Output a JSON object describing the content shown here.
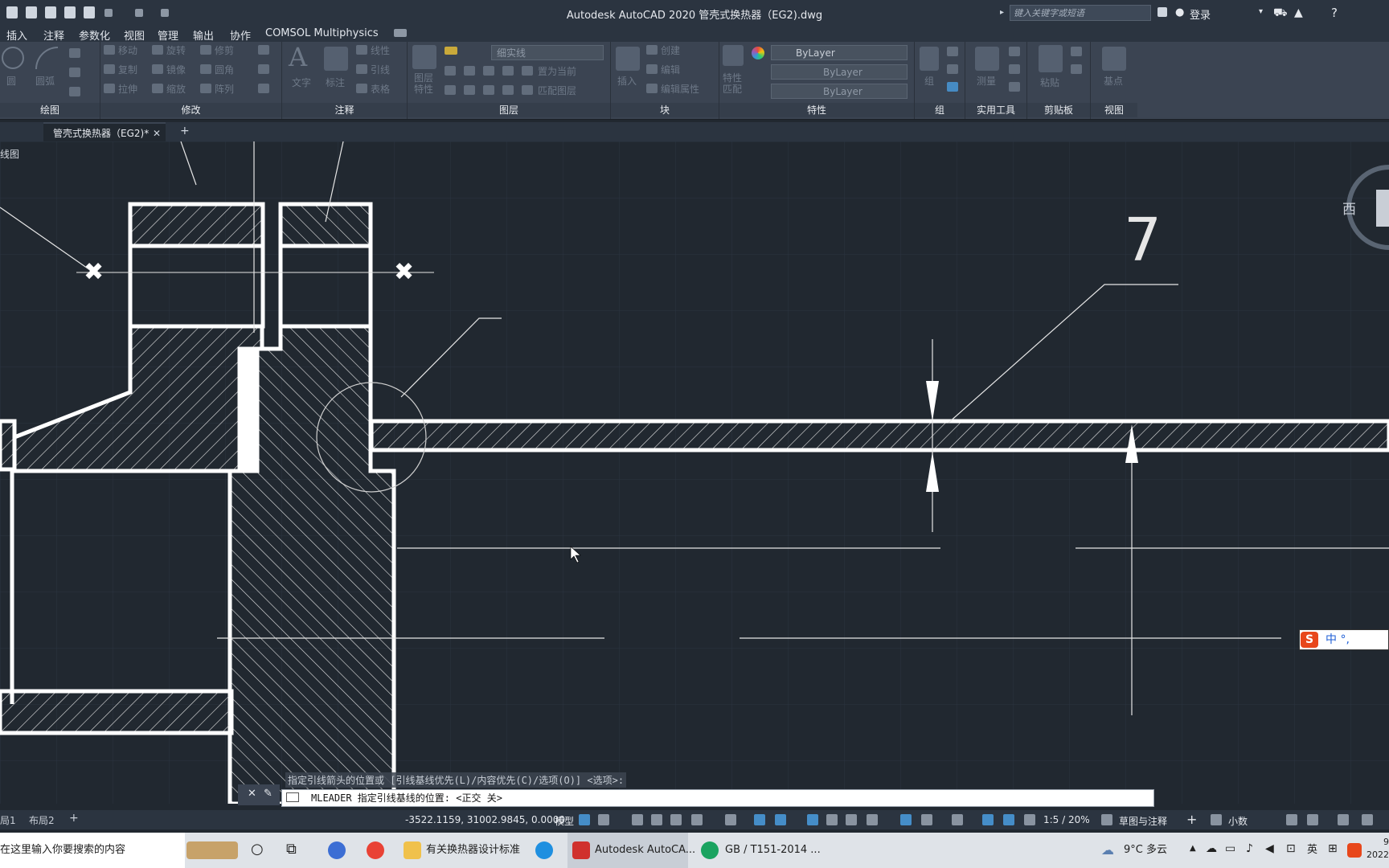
{
  "titlebar": {
    "title": "Autodesk AutoCAD 2020    管壳式换热器（EG2).dwg",
    "search_placeholder": "键入关键字或短语",
    "login_label": "登录"
  },
  "menu": [
    "插入",
    "注释",
    "参数化",
    "视图",
    "管理",
    "输出",
    "协作",
    "COMSOL Multiphysics"
  ],
  "ribbon": {
    "panels": {
      "draw": "绘图",
      "modify": "修改",
      "annotation": "注释",
      "layers": "图层",
      "block": "块",
      "properties": "特性",
      "groups": "组",
      "utilities": "实用工具",
      "clipboard": "剪贴板",
      "view": "视图"
    },
    "draw_tools": {
      "circle": "圆",
      "arc": "圆弧"
    },
    "modify_tools": [
      "移动",
      "旋转",
      "修剪",
      "复制",
      "镜像",
      "圆角",
      "拉伸",
      "缩放",
      "阵列"
    ],
    "annotation_tools": {
      "text": "文字",
      "dimension": "标注",
      "linear": "线性",
      "leader": "引线",
      "table": "表格"
    },
    "layer_tools": {
      "layer_props": "图层\n特性",
      "layer_combo": "细实线",
      "set_current": "置为当前",
      "match_layer": "匹配图层"
    },
    "block_tools": {
      "insert": "插入",
      "create": "创建",
      "edit": "编辑",
      "edit_attr": "编辑属性"
    },
    "properties_tools": {
      "match": "特性\n匹配",
      "color": "ByLayer",
      "linetype": "ByLayer",
      "lineweight": "ByLayer"
    },
    "groups_tools": {
      "group": "组"
    },
    "utilities_tools": {
      "measure": "测量"
    },
    "clipboard_tools": {
      "paste": "粘贴"
    },
    "view_tools": {
      "base": "基点"
    }
  },
  "tabs": {
    "doc_tab": "管壳式换热器（EG2)*",
    "new_tab": "+"
  },
  "viewport": {
    "view_label": "线图",
    "compass_west": "西",
    "leader_number": "7"
  },
  "command": {
    "history": "指定引线箭头的位置或 [引线基线优先(L)/内容优先(C)/选项(O)] <选项>:",
    "prompt": "MLEADER 指定引线基线的位置: <正交 关>"
  },
  "layout_tabs": [
    "局1",
    "布局2"
  ],
  "statusbar": {
    "coords": "-3522.1159, 31002.9845, 0.0000",
    "model": "模型",
    "scale": "1:5 / 20%",
    "workspace": "草图与注释",
    "units": "小数"
  },
  "taskbar": {
    "search_placeholder": "在这里输入你要搜索的内容",
    "apps": [
      "有关换热器设计标准",
      "Autodesk AutoCA...",
      "GB / T151-2014 ..."
    ],
    "weather": "9°C 多云",
    "lang": "英",
    "clock_time": "9",
    "clock_date": "2022"
  },
  "ime": {
    "label": "中 °,"
  },
  "colors": {
    "canvas": "#212830",
    "ribbon": "#3b4452",
    "accent": "#4a9ee0"
  }
}
